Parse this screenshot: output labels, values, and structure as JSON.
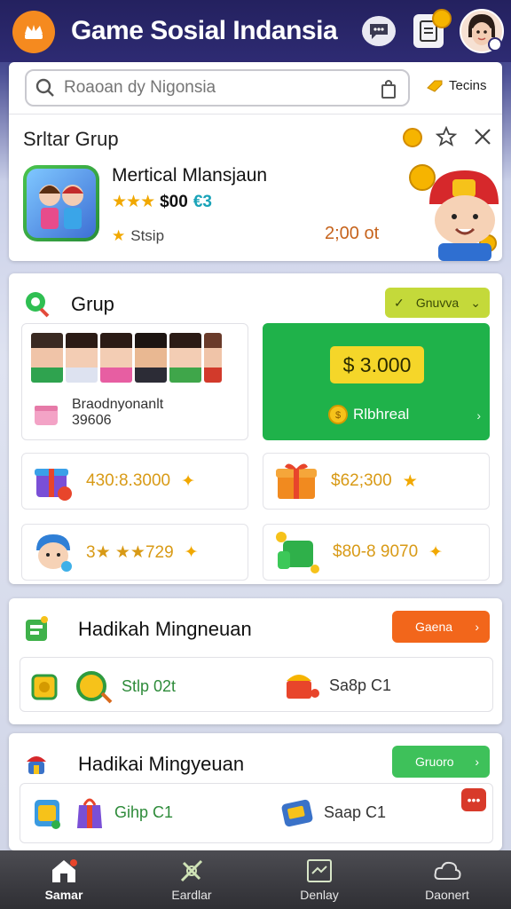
{
  "header": {
    "title": "Game Sosial Indansia"
  },
  "search": {
    "placeholder": "Roaoan dy Nigonsia",
    "filter_label": "Tecins"
  },
  "featured": {
    "section_title": "Srltar Grup",
    "game_name": "Mertical Mlansjaun",
    "stars": "★★★",
    "price": "$00",
    "price_alt": "€3",
    "status": "Stsip",
    "time": "2;00 ot"
  },
  "group": {
    "title": "Grup",
    "dropdown_label": "Gnuvva",
    "member_name": "Braodnyonanlt",
    "member_count": "39606",
    "balance": "$ 3.000",
    "balance_label": "Rlbhreal",
    "rewards": [
      {
        "value": "430:8.3000"
      },
      {
        "value": "$62;300"
      },
      {
        "value": "3★ ★★729"
      },
      {
        "value": "$80-8 9070"
      }
    ]
  },
  "weekly": [
    {
      "title": "Hadikah Mingneuan",
      "button": "Gaena",
      "button_color": "#f2661b",
      "items": [
        "Stlp 02t",
        "Sa8p C1"
      ]
    },
    {
      "title": "Hadikai Mingyeuan",
      "button": "Gruoro",
      "button_color": "#3ec15a",
      "items": [
        "Gihp C1",
        "Saap C1"
      ]
    }
  ],
  "nav": [
    {
      "label": "Samar",
      "icon": "home-icon"
    },
    {
      "label": "Eardlar",
      "icon": "explore-icon"
    },
    {
      "label": "Denlay",
      "icon": "chart-icon"
    },
    {
      "label": "Daonert",
      "icon": "cloud-icon"
    }
  ],
  "colors": {
    "accent": "#f58a1f",
    "header_bg": "#2e2b73",
    "balance_bg": "#1fb24a",
    "chip": "#f5d629"
  }
}
